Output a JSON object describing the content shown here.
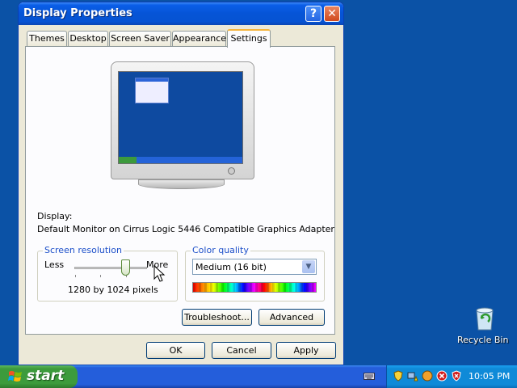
{
  "window": {
    "title": "Display Properties",
    "help_symbol": "?",
    "close_symbol": "✕"
  },
  "tabs": [
    {
      "label": "Themes"
    },
    {
      "label": "Desktop"
    },
    {
      "label": "Screen Saver"
    },
    {
      "label": "Appearance"
    },
    {
      "label": "Settings",
      "active": true
    }
  ],
  "display": {
    "label": "Display:",
    "value": "Default Monitor on Cirrus Logic 5446 Compatible Graphics Adapter"
  },
  "screen_resolution": {
    "legend": "Screen resolution",
    "less_label": "Less",
    "more_label": "More",
    "value_text": "1280 by 1024 pixels",
    "slider_position": 0.72
  },
  "color_quality": {
    "legend": "Color quality",
    "selected": "Medium (16 bit)"
  },
  "buttons": {
    "troubleshoot": "Troubleshoot...",
    "advanced": "Advanced",
    "ok": "OK",
    "cancel": "Cancel",
    "apply": "Apply"
  },
  "desktop": {
    "recycle_bin_label": "Recycle Bin"
  },
  "taskbar": {
    "start_label": "start",
    "clock": "10:05 PM"
  },
  "colors": {
    "desktop": "#0b52a6",
    "titlebar": "#0654d6",
    "dialog": "#ece9d8",
    "accent_tab": "#f5b53c",
    "group_legend": "#1c4fc9",
    "start_button": "#3c9b3c",
    "tray": "#0f8ad8"
  }
}
